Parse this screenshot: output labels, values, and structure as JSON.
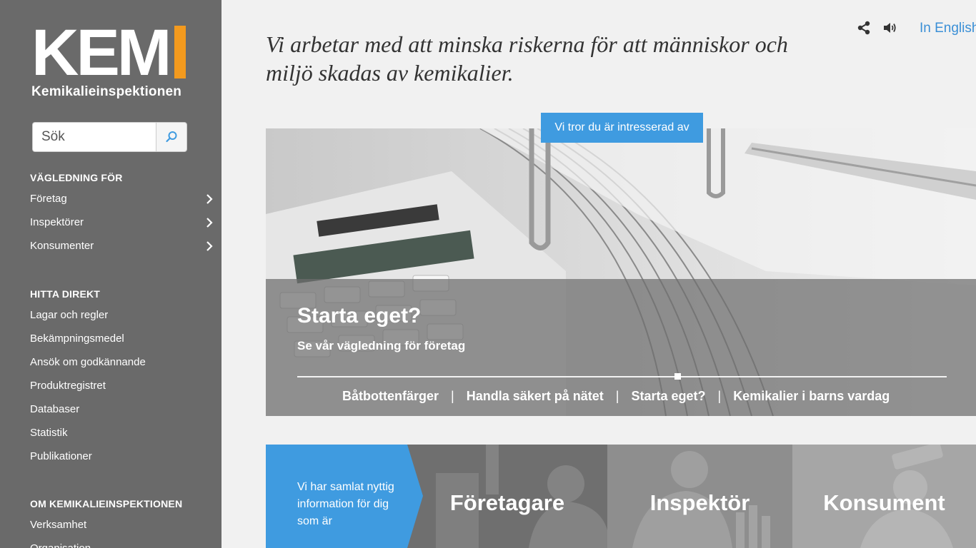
{
  "logo": {
    "letters": "KEM",
    "subtitle": "Kemikalieinspektionen"
  },
  "search": {
    "placeholder": "Sök"
  },
  "nav": {
    "guidance_heading": "VÄGLEDNING FÖR",
    "guidance_items": [
      "Företag",
      "Inspektörer",
      "Konsumenter"
    ],
    "direct_heading": "HITTA DIREKT",
    "direct_items": [
      "Lagar och regler",
      "Bekämpningsmedel",
      "Ansök om godkännande",
      "Produktregistret",
      "Databaser",
      "Statistik",
      "Publikationer"
    ],
    "about_heading": "OM KEMIKALIEINSPEKTIONEN",
    "about_items": [
      "Verksamhet",
      "Organisation"
    ]
  },
  "header": {
    "language_link": "In English",
    "icons": [
      "share-icon",
      "speaker-icon"
    ],
    "tagline": "Vi arbetar med att minska riskerna för att människor och miljö skadas av kemikalier."
  },
  "interest_button": "Vi tror du är intresserad av",
  "hero": {
    "title": "Starta eget?",
    "subtitle": "Se vår vägledning för företag",
    "links": [
      "Båtbottenfärger",
      "Handla säkert på nätet",
      "Starta eget?",
      "Kemikalier i barns vardag"
    ],
    "separator": "|"
  },
  "tiles": {
    "intro": "Vi har samlat nyttig information för dig som är",
    "items": [
      "Företagare",
      "Inspektör",
      "Konsument"
    ]
  },
  "colors": {
    "sidebar": "#6a6a6a",
    "accent": "#3f9be0",
    "logo_bar": "#f39a1e",
    "link": "#3a8fd6"
  }
}
